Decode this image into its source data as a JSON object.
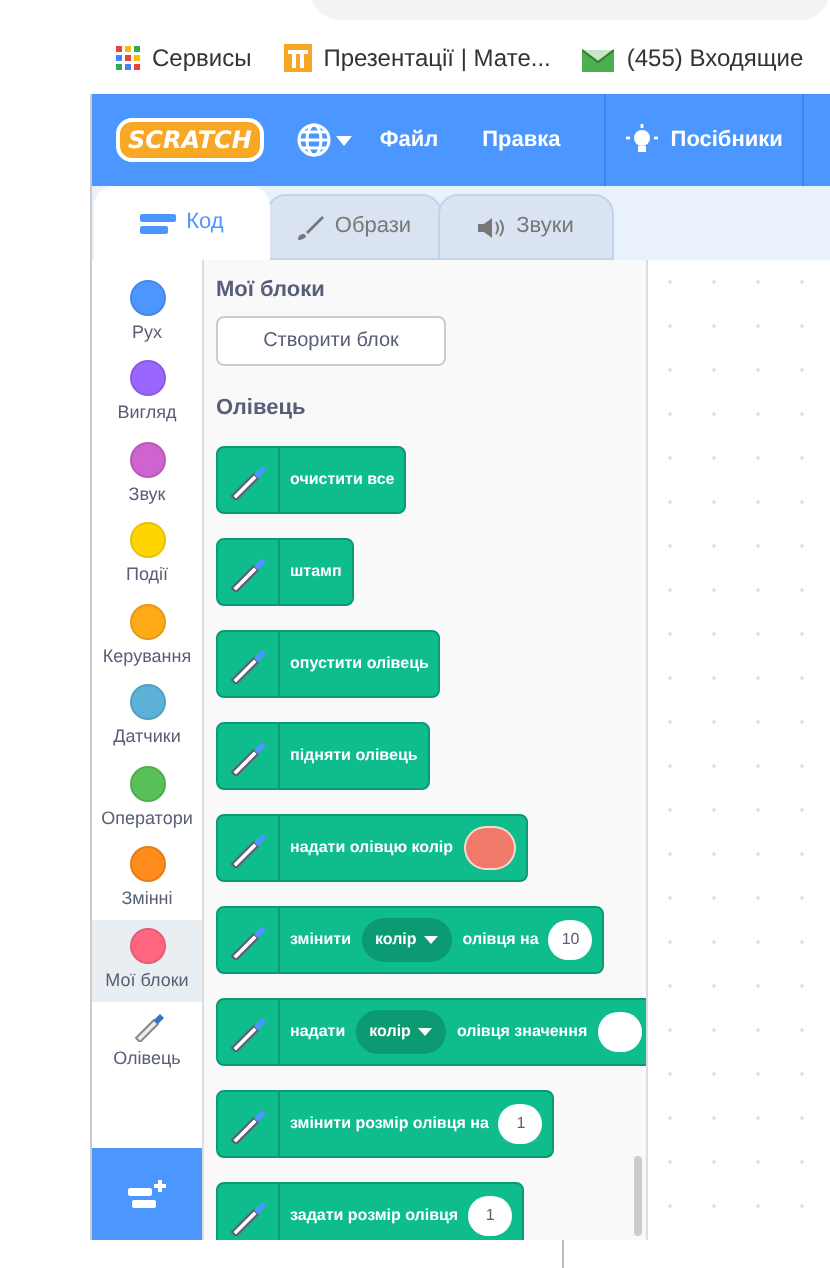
{
  "bookmarks": [
    {
      "kind": "apps",
      "label": "Сервисы"
    },
    {
      "kind": "pi",
      "label": "Презентації | Мате..."
    },
    {
      "kind": "mail",
      "label": "(455) Входящие"
    }
  ],
  "menu_bar": {
    "logo": "SCRATCH",
    "items": [
      {
        "kind": "globe"
      },
      {
        "kind": "text",
        "label": "Файл"
      },
      {
        "kind": "text",
        "label": "Правка"
      },
      {
        "kind": "tutorial",
        "label": "Посібники"
      }
    ]
  },
  "tabs": [
    {
      "kind": "code",
      "label": "Код",
      "selected": true
    },
    {
      "kind": "brush",
      "label": "Образи",
      "selected": false
    },
    {
      "kind": "sound",
      "label": "Звуки",
      "selected": false
    }
  ],
  "categories": [
    {
      "kind": "dot",
      "label": "Рух",
      "color": "#4c97ff",
      "selected": false
    },
    {
      "kind": "dot",
      "label": "Вигляд",
      "color": "#9966ff",
      "selected": false
    },
    {
      "kind": "dot",
      "label": "Звук",
      "color": "#cf63cf",
      "selected": false
    },
    {
      "kind": "dot",
      "label": "Події",
      "color": "#ffd500",
      "selected": false
    },
    {
      "kind": "dot",
      "label": "Керування",
      "color": "#ffab19",
      "selected": false
    },
    {
      "kind": "dot",
      "label": "Датчики",
      "color": "#5cb1d6",
      "selected": false
    },
    {
      "kind": "dot",
      "label": "Оператори",
      "color": "#59c059",
      "selected": false
    },
    {
      "kind": "dot",
      "label": "Змінні",
      "color": "#ff8c1a",
      "selected": false
    },
    {
      "kind": "dot",
      "label": "Мої блоки",
      "color": "#ff6680",
      "selected": true
    },
    {
      "kind": "pen",
      "label": "Олівець",
      "selected": false
    }
  ],
  "palette": {
    "my_blocks_heading": "Мої блоки",
    "make_block_button": "Створити блок",
    "pen_heading": "Олівець",
    "blocks": [
      {
        "segments": [
          {
            "kind": "text",
            "text": "очистити все"
          }
        ]
      },
      {
        "segments": [
          {
            "kind": "text",
            "text": "штамп"
          }
        ]
      },
      {
        "segments": [
          {
            "kind": "text",
            "text": "опустити олівець"
          }
        ]
      },
      {
        "segments": [
          {
            "kind": "text",
            "text": "підняти олівець"
          }
        ]
      },
      {
        "segments": [
          {
            "kind": "text",
            "text": "надати олівцю колір"
          },
          {
            "kind": "color",
            "color": "#f07a6a"
          }
        ]
      },
      {
        "segments": [
          {
            "kind": "text",
            "text": "змінити"
          },
          {
            "kind": "dropdown",
            "text": "колір"
          },
          {
            "kind": "text",
            "text": "олівця на"
          },
          {
            "kind": "number",
            "text": "10"
          }
        ]
      },
      {
        "segments": [
          {
            "kind": "text",
            "text": "надати"
          },
          {
            "kind": "dropdown",
            "text": "колір"
          },
          {
            "kind": "text",
            "text": "олівця значення"
          },
          {
            "kind": "number"
          }
        ]
      },
      {
        "segments": [
          {
            "kind": "text",
            "text": "змінити розмір олівця на"
          },
          {
            "kind": "number",
            "text": "1"
          }
        ]
      },
      {
        "segments": [
          {
            "kind": "text",
            "text": "задати розмір олівця"
          },
          {
            "kind": "number",
            "text": "1"
          }
        ]
      }
    ]
  }
}
